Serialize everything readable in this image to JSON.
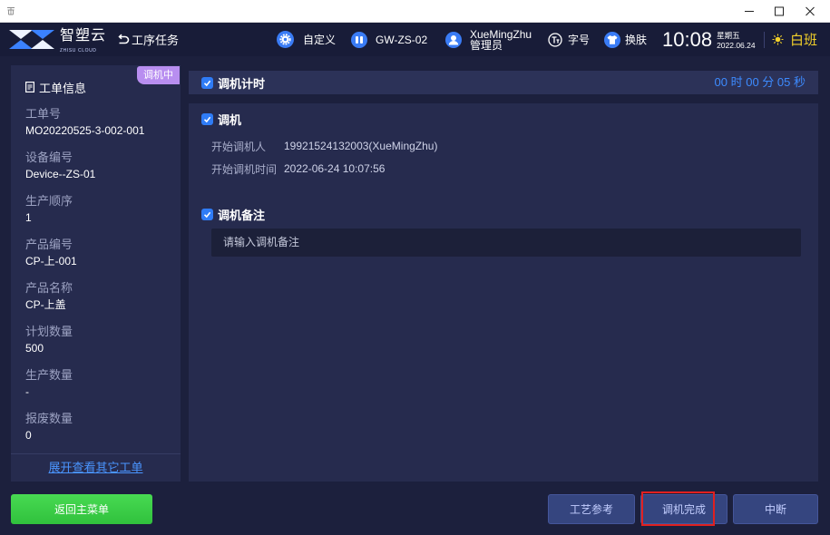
{
  "window": {
    "app_icon": "app-icon",
    "controls": [
      "minimize-icon",
      "maximize-icon",
      "close-icon"
    ]
  },
  "header": {
    "brand": {
      "name": "智塑云",
      "subtitle": "ZHISU CLOUD",
      "icon": "zhisu-logo-icon"
    },
    "back": {
      "label": "工序任务",
      "icon": "back-arrow-icon"
    },
    "customize": {
      "label": "自定义",
      "icon": "gear-icon"
    },
    "station": {
      "label": "GW-ZS-02",
      "icon": "station-icon"
    },
    "user": {
      "name": "XueMingZhu",
      "role": "管理员",
      "icon": "user-avatar-icon"
    },
    "font_size": {
      "label": "字号",
      "icon": "font-size-icon"
    },
    "skin": {
      "label": "换肤",
      "icon": "shirt-icon"
    },
    "clock": {
      "time": "10:08",
      "weekday": "星期五",
      "date": "2022.06.24"
    },
    "shift": {
      "label": "白班",
      "icon": "sun-icon"
    }
  },
  "sidebar": {
    "status_badge": "调机中",
    "title": "工单信息",
    "title_icon": "document-icon",
    "fields": [
      {
        "label": "工单号",
        "value": "MO20220525-3-002-001"
      },
      {
        "label": "设备编号",
        "value": "Device--ZS-01"
      },
      {
        "label": "生产顺序",
        "value": "1"
      },
      {
        "label": "产品编号",
        "value": "CP-上-001"
      },
      {
        "label": "产品名称",
        "value": "CP-上盖"
      },
      {
        "label": "计划数量",
        "value": "500"
      },
      {
        "label": "生产数量",
        "value": "-"
      },
      {
        "label": "报废数量",
        "value": "0"
      }
    ],
    "expand_link": "展开查看其它工单"
  },
  "timer": {
    "title": "调机计时",
    "elapsed": "00 时 00 分 05 秒",
    "icon": "section-icon"
  },
  "setup": {
    "title": "调机",
    "icon": "section-icon",
    "rows": [
      {
        "label": "开始调机人",
        "value": "19921524132003(XueMingZhu)"
      },
      {
        "label": "开始调机时间",
        "value": "2022-06-24 10:07:56"
      }
    ]
  },
  "remarks": {
    "title": "调机备注",
    "icon": "section-icon",
    "value": "",
    "placeholder": "请输入调机备注"
  },
  "footer": {
    "back_to_main": "返回主菜单",
    "process_reference": "工艺参考",
    "finish_setup": "调机完成",
    "interrupt": "中断"
  },
  "colors": {
    "accent": "#3d8bff",
    "badge": "#b88ef0",
    "primary_button": "#30c13d",
    "shift": "#f3d12a",
    "highlight": "#e02020"
  }
}
